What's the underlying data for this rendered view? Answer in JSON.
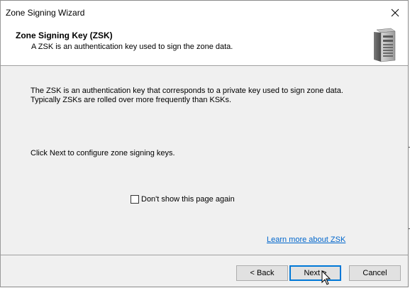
{
  "window": {
    "title": "Zone Signing Wizard",
    "close_icon": "close-icon"
  },
  "header": {
    "title": "Zone Signing Key (ZSK)",
    "subtitle": "A ZSK is an authentication key used to sign the zone data.",
    "icon": "server-icon"
  },
  "content": {
    "description_line1": "The ZSK is an authentication key that corresponds to a private key used to sign zone data.",
    "description_line2": "Typically ZSKs are rolled over more frequently than KSKs.",
    "instruction": "Click Next to configure zone signing keys.",
    "checkbox_label": "Don't show this page again",
    "checkbox_checked": false,
    "learn_more_link": "Learn more about ZSK"
  },
  "footer": {
    "back_label": "< Back",
    "next_label": "Next >",
    "cancel_label": "Cancel"
  },
  "colors": {
    "link": "#0066cc",
    "default_button_border": "#0078d7",
    "dialog_background": "#f0f0f0"
  }
}
